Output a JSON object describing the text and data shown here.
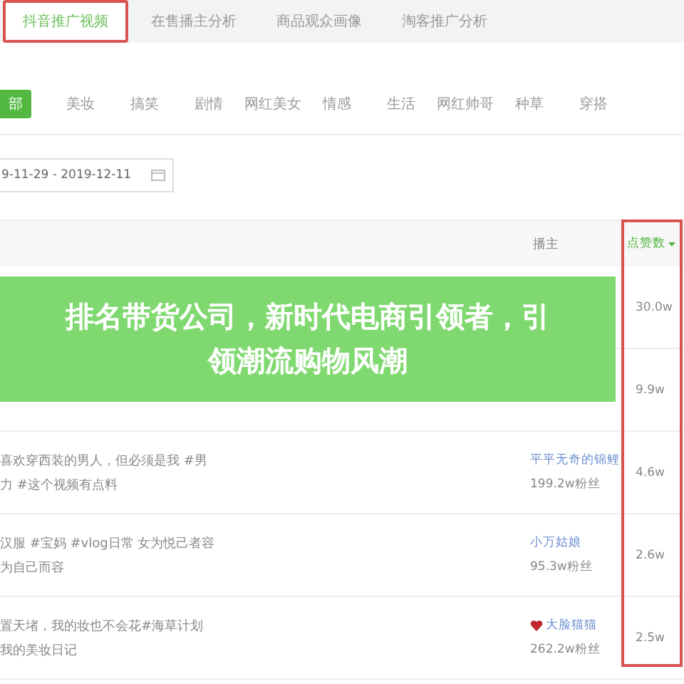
{
  "tabs": [
    {
      "label": "抖音推广视频",
      "selected": true
    },
    {
      "label": "在售播主分析",
      "selected": false
    },
    {
      "label": "商品观众画像",
      "selected": false
    },
    {
      "label": "淘客推广分析",
      "selected": false
    }
  ],
  "categories": [
    {
      "label": "部",
      "selected": true
    },
    {
      "label": "美妆",
      "selected": false
    },
    {
      "label": "搞笑",
      "selected": false
    },
    {
      "label": "剧情",
      "selected": false
    },
    {
      "label": "网红美女",
      "selected": false
    },
    {
      "label": "情感",
      "selected": false
    },
    {
      "label": "生活",
      "selected": false
    },
    {
      "label": "网红帅哥",
      "selected": false
    },
    {
      "label": "种草",
      "selected": false
    },
    {
      "label": "穿搭",
      "selected": false
    }
  ],
  "date_range": {
    "value": "9-11-29 - 2019-12-11"
  },
  "table": {
    "columns": [
      "播主",
      "点赞数"
    ],
    "rows": [
      {
        "likes": "30.0w"
      },
      {
        "likes": "9.9w"
      },
      {
        "description": [
          "喜欢穿西装的男人，但必须是我 #男",
          "力 #这个视频有点料"
        ],
        "author": "平平无奇的锦鲤",
        "followers": "199.2w粉丝",
        "likes": "4.6w",
        "heart": false
      },
      {
        "description": [
          "汉服 #宝妈 #vlog日常 女为悦己者容",
          "为自己而容"
        ],
        "author": "小万姑娘",
        "followers": "95.3w粉丝",
        "likes": "2.6w",
        "heart": false
      },
      {
        "description": [
          "置天堵，我的妆也不会花#海草计划",
          "我的美妆日记"
        ],
        "author": "大脸猫猫",
        "followers": "262.2w粉丝",
        "likes": "2.5w",
        "heart": true
      }
    ]
  },
  "banner": {
    "lines": [
      "排名带货公司，新时代电商引领者，引",
      "领潮流购物风潮"
    ]
  }
}
